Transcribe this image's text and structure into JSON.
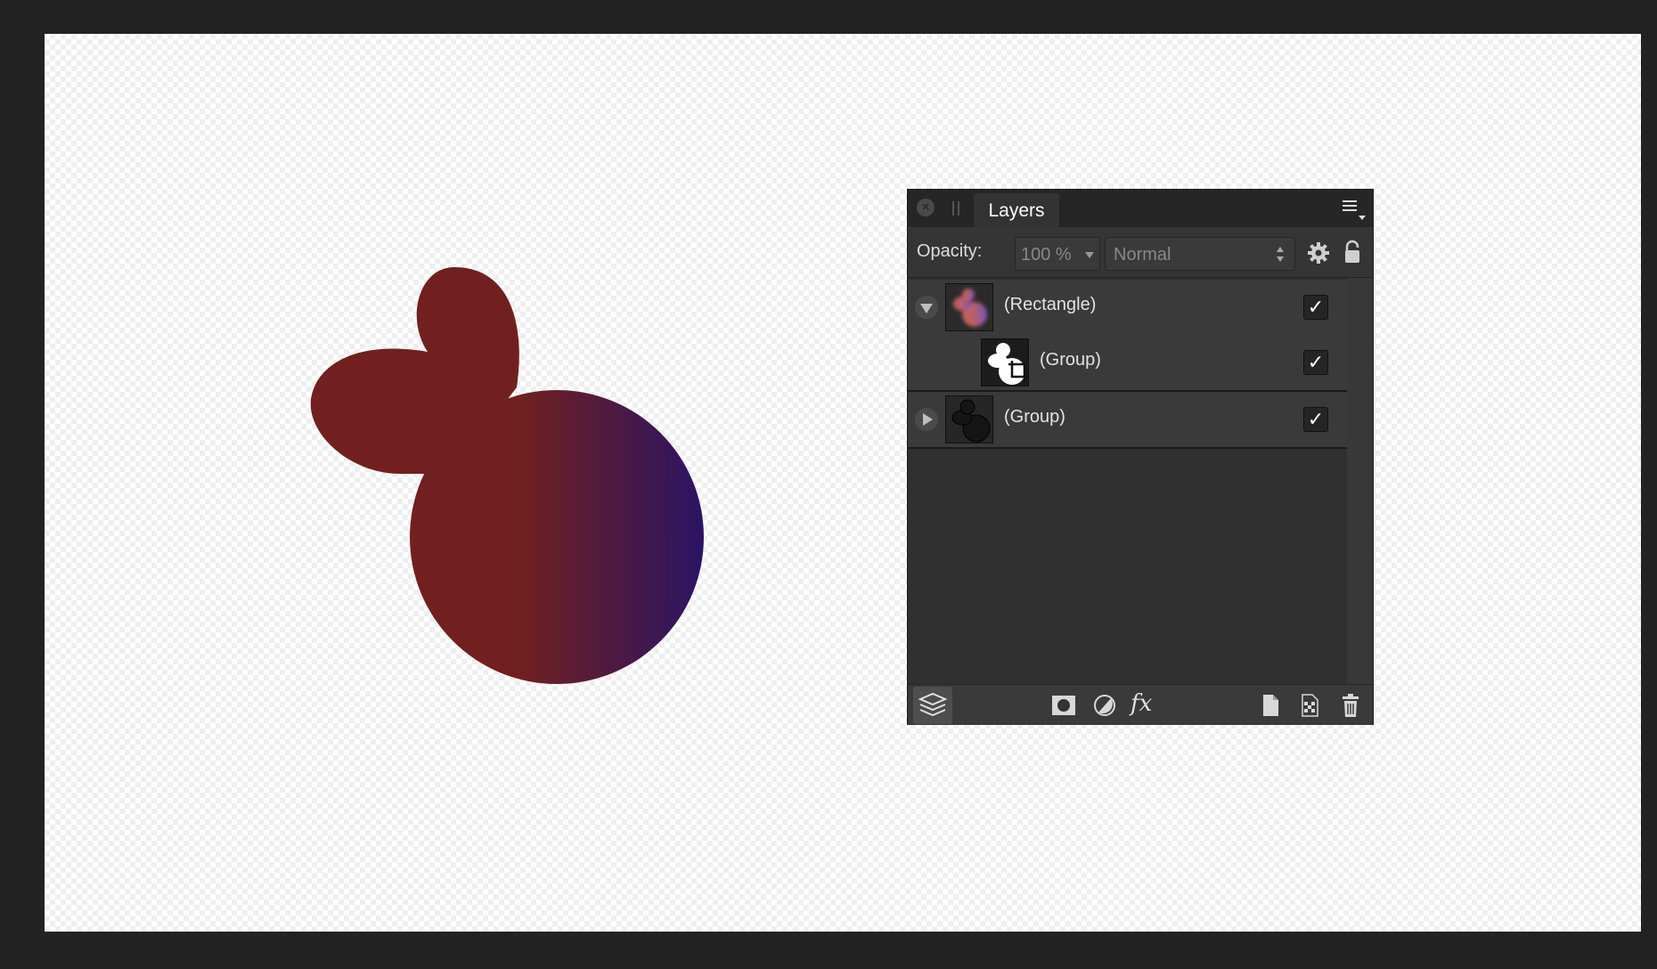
{
  "layers_panel": {
    "tab_label": "Layers",
    "opacity_label": "Opacity:",
    "opacity_value": "100 %",
    "blend_mode": "Normal",
    "layers": [
      {
        "name": "(Rectangle)",
        "visible": true,
        "expanded": true
      },
      {
        "name": "(Group)",
        "visible": true,
        "child": true
      },
      {
        "name": "(Group)",
        "visible": true,
        "expanded": false
      }
    ],
    "checkmark": "✓",
    "close_glyph": "×",
    "fx_label": "fx",
    "icons": [
      "close-icon",
      "panel-menu-icon",
      "gear-icon",
      "lock-icon",
      "expand-triangle-icon",
      "collapse-triangle-icon",
      "layers-stack-icon",
      "mask-icon",
      "adjustment-icon",
      "fx-icon",
      "new-layer-icon",
      "new-pixel-layer-icon",
      "trash-icon"
    ]
  },
  "artwork": {
    "gradient_start": "#71201f",
    "gradient_end": "#2b1463"
  }
}
